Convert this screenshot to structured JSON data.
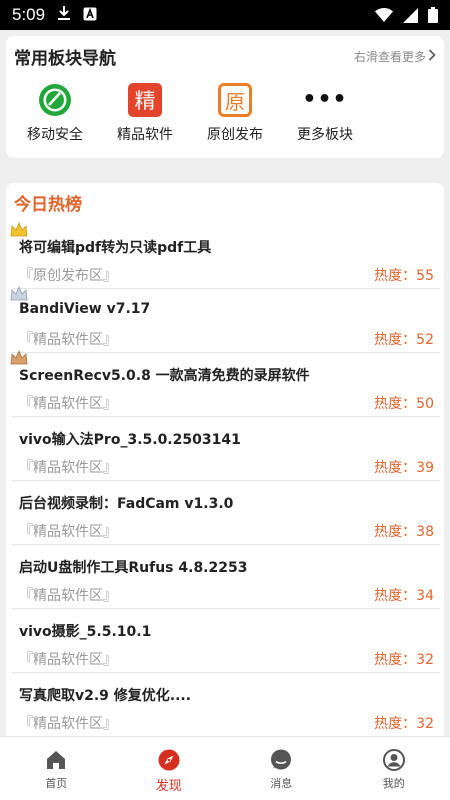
{
  "status_bar": {
    "time": "5:09"
  },
  "nav_card": {
    "title": "常用板块导航",
    "more_label": "右滑查看更多",
    "items": [
      {
        "label": "移动安全",
        "icon": "shield-icon"
      },
      {
        "label": "精品软件",
        "icon": "jing-badge-icon",
        "glyph": "精"
      },
      {
        "label": "原创发布",
        "icon": "yuan-badge-icon",
        "glyph": "原"
      },
      {
        "label": "更多板块",
        "icon": "more-dots-icon",
        "glyph": "•••"
      }
    ]
  },
  "hot_card": {
    "title": "今日热榜",
    "items": [
      {
        "title": "将可编辑pdf转为只读pdf工具",
        "category": "『原创发布区』",
        "heat": "热度：55",
        "rank_icon": "gold-crown-icon"
      },
      {
        "title": "BandiView v7.17",
        "category": "『精品软件区』",
        "heat": "热度：52",
        "rank_icon": "silver-crown-icon"
      },
      {
        "title": "ScreenRecv5.0.8 一款高清免费的录屏软件",
        "category": "『精品软件区』",
        "heat": "热度：50",
        "rank_icon": "bronze-crown-icon"
      },
      {
        "title": "vivo输入法Pro_3.5.0.2503141",
        "category": "『精品软件区』",
        "heat": "热度：39"
      },
      {
        "title": "后台视频录制：FadCam v1.3.0",
        "category": "『精品软件区』",
        "heat": "热度：38"
      },
      {
        "title": "启动U盘制作工具Rufus 4.8.2253",
        "category": "『精品软件区』",
        "heat": "热度：34"
      },
      {
        "title": "vivo摄影_5.5.10.1",
        "category": "『精品软件区』",
        "heat": "热度：32"
      },
      {
        "title": "写真爬取v2.9 修复优化....",
        "category": "『精品软件区』",
        "heat": "热度：32"
      }
    ]
  },
  "bottom_nav": {
    "tabs": [
      {
        "label": "首页",
        "icon": "home-icon"
      },
      {
        "label": "发现",
        "icon": "compass-icon",
        "active": true
      },
      {
        "label": "消息",
        "icon": "chat-icon"
      },
      {
        "label": "我的",
        "icon": "user-icon"
      }
    ]
  },
  "colors": {
    "accent": "#e2642a",
    "active_tab": "#d5301f",
    "jing_badge": "#e2452b",
    "yuan_badge": "#ee7d25",
    "shield": "#22a83a"
  }
}
